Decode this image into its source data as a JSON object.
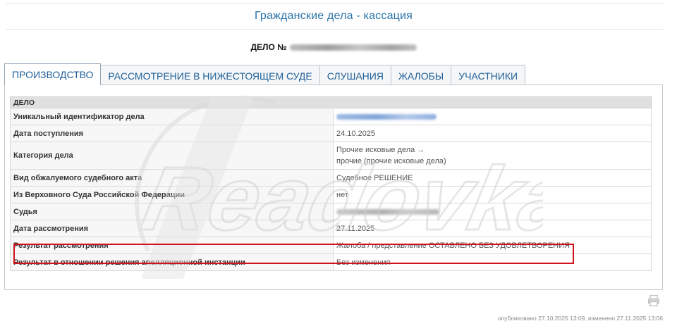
{
  "page": {
    "title": "Гражданские дела - кассация",
    "case_label": "ДЕЛО №"
  },
  "tabs": [
    {
      "label": "ПРОИЗВОДСТВО",
      "active": true
    },
    {
      "label": "РАССМОТРЕНИЕ В НИЖЕСТОЯЩЕМ СУДЕ",
      "active": false
    },
    {
      "label": "СЛУШАНИЯ",
      "active": false
    },
    {
      "label": "ЖАЛОБЫ",
      "active": false
    },
    {
      "label": "УЧАСТНИКИ",
      "active": false
    }
  ],
  "case_table": {
    "header": "ДЕЛО",
    "rows": [
      {
        "label": "Уникальный идентификатор дела",
        "value": ""
      },
      {
        "label": "Дата поступления",
        "value": "24.10.2025"
      },
      {
        "label": "Категория дела",
        "value_line1": "Прочие исковые дела →",
        "value_line2": "прочие (прочие исковые дела)"
      },
      {
        "label": "Вид обжалуемого судебного акта",
        "value": "Судебное РЕШЕНИЕ"
      },
      {
        "label": "Из Верховного Суда Российской Федерации",
        "value": "нет"
      },
      {
        "label": "Судья",
        "value": ""
      },
      {
        "label": "Дата рассмотрения",
        "value": "27.11.2025"
      },
      {
        "label": "Результат рассмотрения",
        "value": "Жалоба / представление ОСТАВЛЕНО БЕЗ УДОВЛЕТВОРЕНИЯ",
        "highlighted": true
      },
      {
        "label": "Результат в отношении решения апелляционной инстанции",
        "value": "Без изменения"
      }
    ]
  },
  "watermark": {
    "text": "Readovka"
  },
  "footer": {
    "meta": "опубликовано 27.10.2025 13:09, изменено 27.11.2025 13:06",
    "print_icon": "printer-icon"
  },
  "colors": {
    "title": "#2a73a8",
    "tab_text": "#1f5f97",
    "highlight_border": "#d0121b"
  }
}
